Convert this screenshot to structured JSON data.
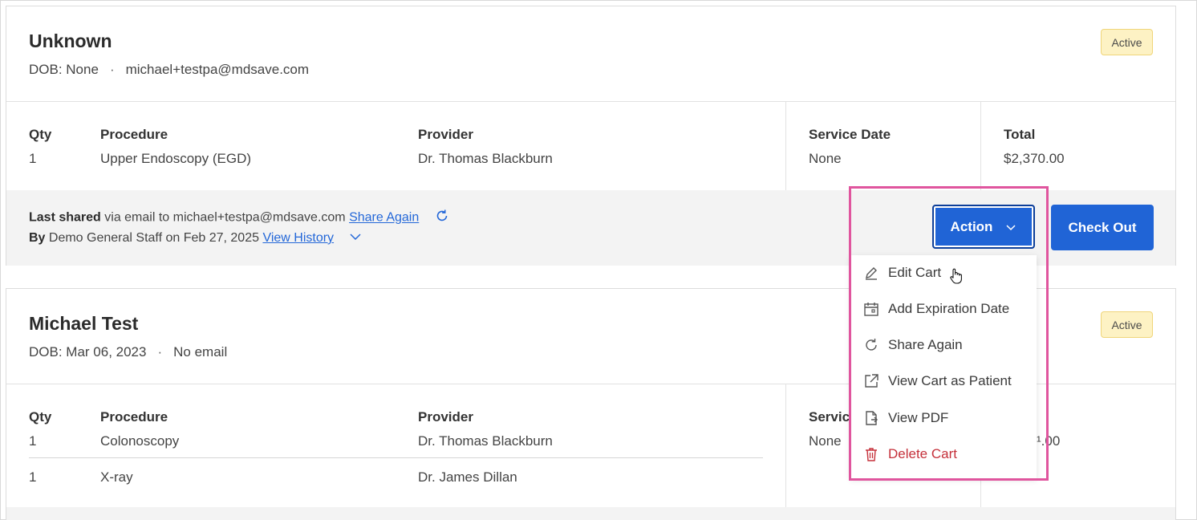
{
  "carts": [
    {
      "name": "Unknown",
      "dob": "DOB: None",
      "email": "michael+testpa@mdsave.com",
      "status": "Active",
      "columns": {
        "qty": "Qty",
        "procedure": "Procedure",
        "provider": "Provider",
        "service_date": "Service Date",
        "total": "Total"
      },
      "items": [
        {
          "qty": "1",
          "procedure": "Upper Endoscopy (EGD)",
          "provider": "Dr. Thomas Blackburn"
        }
      ],
      "service_date": "None",
      "total": "$2,370.00",
      "share": {
        "last_shared_label": "Last shared",
        "via_text": " via email to michael+testpa@mdsave.com ",
        "share_again_link": "Share Again",
        "by_label": "By",
        "by_text": " Demo General Staff on Feb 27, 2025 ",
        "view_history_link": "View History"
      },
      "action_button": "Action",
      "checkout_button": "Check Out"
    },
    {
      "name": "Michael Test",
      "dob": "DOB: Mar 06, 2023",
      "email": "No email",
      "status": "Active",
      "columns": {
        "qty": "Qty",
        "procedure": "Procedure",
        "provider": "Provider",
        "service_date": "Servic"
      },
      "items": [
        {
          "qty": "1",
          "procedure": "Colonoscopy",
          "provider": "Dr. Thomas Blackburn"
        },
        {
          "qty": "1",
          "procedure": "X-ray",
          "provider": "Dr. James Dillan"
        }
      ],
      "service_date": "None",
      "total_partial": "¹.00"
    }
  ],
  "action_menu": {
    "items": [
      {
        "label": "Edit Cart",
        "icon": "pencil-icon"
      },
      {
        "label": "Add Expiration Date",
        "icon": "calendar-icon"
      },
      {
        "label": "Share Again",
        "icon": "refresh-icon"
      },
      {
        "label": "View Cart as Patient",
        "icon": "external-link-icon"
      },
      {
        "label": "View PDF",
        "icon": "pdf-file-icon"
      },
      {
        "label": "Delete Cart",
        "icon": "trash-icon",
        "color": "#c5303a"
      }
    ]
  },
  "colors": {
    "primary": "#2064d6",
    "badge_bg": "#fdf2c4",
    "highlight": "#e0559e",
    "danger": "#c5303a"
  }
}
